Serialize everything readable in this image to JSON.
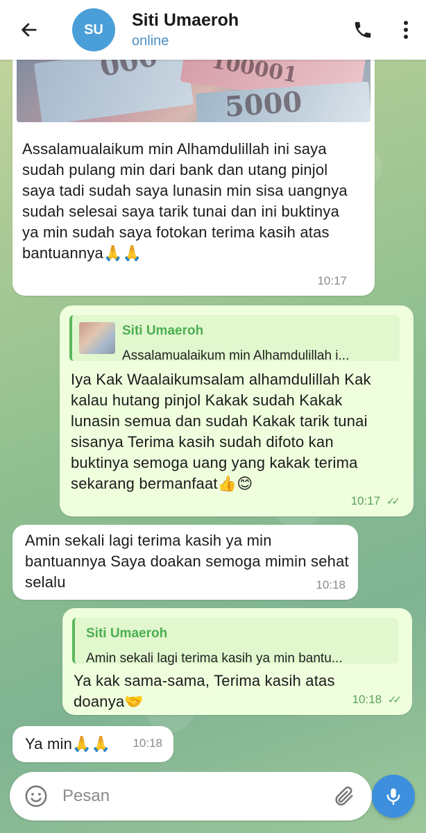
{
  "header": {
    "avatar_initials": "SU",
    "contact_name": "Siti Umaeroh",
    "status": "online",
    "back_icon": "arrow-left-icon",
    "call_icon": "phone-icon",
    "more_icon": "more-vertical-icon"
  },
  "messages": [
    {
      "direction": "incoming",
      "has_photo": true,
      "photo_texts": [
        "000",
        "100001",
        "5000"
      ],
      "text": "Assalamualaikum min Alhamdulillah ini saya sudah pulang min dari bank dan utang pinjol saya tadi sudah saya lunasin min sisa uangnya sudah selesai saya tarik tunai dan ini buktinya ya min sudah saya fotokan terima kasih atas bantuannya🙏🙏",
      "time": "10:17"
    },
    {
      "direction": "outgoing",
      "reply_to": {
        "name": "Siti Umaeroh",
        "text": "Assalamualaikum min Alhamdulillah i..."
      },
      "text": "Iya Kak Waalaikumsalam alhamdulillah Kak kalau hutang pinjol Kakak sudah Kakak lunasin semua dan sudah Kakak tarik tunai sisanya Terima kasih sudah difoto kan buktinya semoga uang yang kakak terima sekarang bermanfaat👍😊",
      "time": "10:17",
      "ticks": "✓✓"
    },
    {
      "direction": "incoming",
      "text": "Amin sekali lagi terima kasih ya min bantuannya Saya doakan semoga mimin sehat selalu",
      "time": "10:18"
    },
    {
      "direction": "outgoing",
      "reply_to": {
        "name": "Siti Umaeroh",
        "text": "Amin sekali lagi terima kasih ya min bantu..."
      },
      "text": "Ya kak sama-sama, Terima kasih atas doanya🤝",
      "time": "10:18",
      "ticks": "✓✓"
    },
    {
      "direction": "incoming",
      "text": "Ya min🙏🙏",
      "time": "10:18"
    }
  ],
  "composer": {
    "placeholder": "Pesan",
    "emoji_icon": "emoji-icon",
    "attach_icon": "paperclip-icon",
    "mic_icon": "microphone-icon"
  },
  "colors": {
    "accent": "#3d8fde",
    "outgoing_bubble": "#effedd",
    "incoming_bubble": "#ffffff",
    "quote_accent": "#5cb85c"
  }
}
